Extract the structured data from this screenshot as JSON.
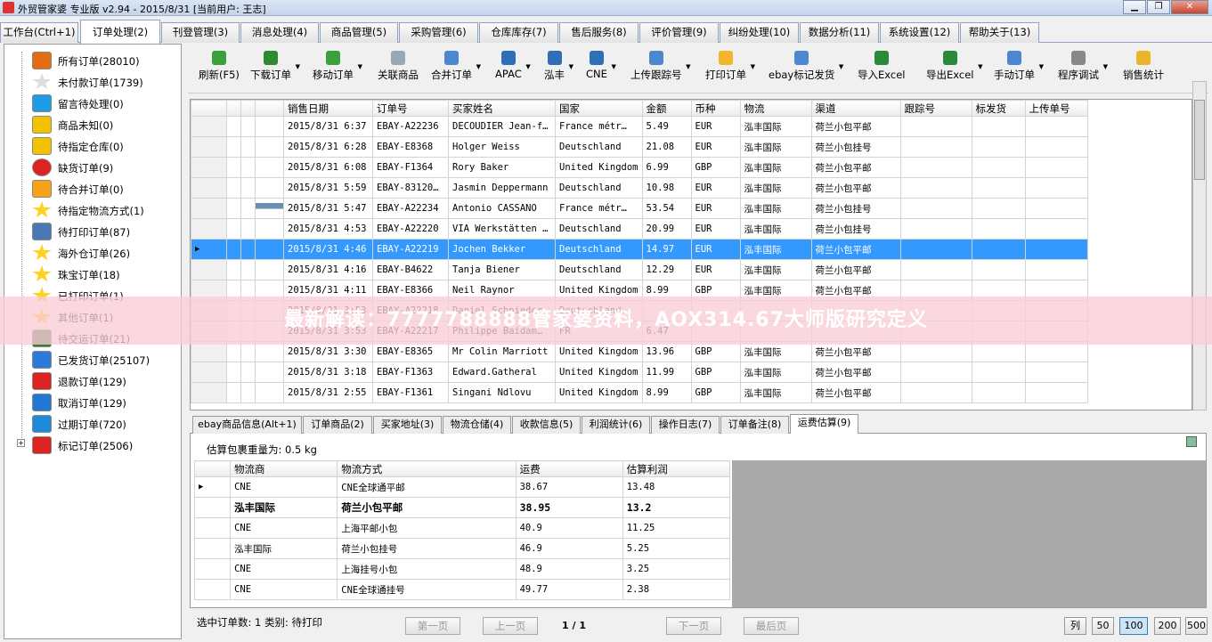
{
  "title": "外贸管家婆 专业版 v2.94 - 2015/8/31 [当前用户: 王志]",
  "window_buttons": {
    "min": "▁",
    "max": "❐",
    "close": "✕"
  },
  "main_tabs": [
    "工作台(Ctrl+1)",
    "订单处理(2)",
    "刊登管理(3)",
    "消息处理(4)",
    "商品管理(5)",
    "采购管理(6)",
    "仓库库存(7)",
    "售后服务(8)",
    "评价管理(9)",
    "纠纷处理(10)",
    "数据分析(11)",
    "系统设置(12)",
    "帮助关于(13)"
  ],
  "tree": [
    {
      "label": "所有订单(28010)",
      "icon": "house-icon",
      "color": "#e46c12"
    },
    {
      "label": "未付款订单(1739)",
      "icon": "star-outline-icon",
      "color": "#ffffff"
    },
    {
      "label": "留言待处理(0)",
      "icon": "speech-bubble-icon",
      "color": "#1e9be6"
    },
    {
      "label": "商品未知(0)",
      "icon": "warning-icon",
      "color": "#f2c200"
    },
    {
      "label": "待指定仓库(0)",
      "icon": "warning-icon",
      "color": "#f2c200"
    },
    {
      "label": "缺货订单(9)",
      "icon": "no-entry-icon",
      "color": "#dd2222"
    },
    {
      "label": "待合并订单(0)",
      "icon": "folder-icon",
      "color": "#f7a21a"
    },
    {
      "label": "待指定物流方式(1)",
      "icon": "star-icon",
      "color": "#ffd21f"
    },
    {
      "label": "待打印订单(87)",
      "icon": "printer-icon",
      "color": "#4a78b5"
    },
    {
      "label": "海外仓订单(26)",
      "icon": "star-icon",
      "color": "#ffd21f"
    },
    {
      "label": "珠宝订单(18)",
      "icon": "star-icon",
      "color": "#ffd21f"
    },
    {
      "label": "已打印订单(1)",
      "icon": "star-icon",
      "color": "#ffd21f"
    },
    {
      "label": "其他订单(1)",
      "icon": "star-icon",
      "color": "#ffd21f"
    },
    {
      "label": "待交运订单(21)",
      "icon": "person-icon",
      "color": "#3a7d3a"
    },
    {
      "label": "已发货订单(25107)",
      "icon": "truck-icon",
      "color": "#2c7bd8"
    },
    {
      "label": "退款订单(129)",
      "icon": "refund-icon",
      "color": "#dd2222"
    },
    {
      "label": "取消订单(129)",
      "icon": "cancel-icon",
      "color": "#1f78d1"
    },
    {
      "label": "过期订单(720)",
      "icon": "expired-icon",
      "color": "#1f8ad8"
    },
    {
      "label": "标记订单(2506)",
      "icon": "flag-icon",
      "color": "#dd2222"
    }
  ],
  "toolbar": [
    {
      "label": "刷新(F5)",
      "icon": "refresh-icon",
      "color": "#3aa03a",
      "dropdown": false
    },
    {
      "label": "下载订单",
      "icon": "download-icon",
      "color": "#2f8a2f",
      "dropdown": true
    },
    {
      "label": "移动订单",
      "icon": "move-icon",
      "color": "#3aa03a",
      "dropdown": true
    },
    {
      "label": "关联商品",
      "icon": "link-icon",
      "color": "#9aa6b2",
      "dropdown": false
    },
    {
      "label": "合并订单",
      "icon": "merge-icon",
      "color": "#4c88cf",
      "dropdown": true
    },
    {
      "label": "APAC",
      "icon": "apac-icon",
      "color": "#2e6fb8",
      "dropdown": true
    },
    {
      "label": "泓丰",
      "icon": "hongfeng-icon",
      "color": "#2e6fb8",
      "dropdown": true
    },
    {
      "label": "CNE",
      "icon": "cne-icon",
      "color": "#2e6fb8",
      "dropdown": true
    },
    {
      "label": "上传跟踪号",
      "icon": "upload-icon",
      "color": "#4c88cf",
      "dropdown": true
    },
    {
      "label": "打印订单",
      "icon": "print-icon",
      "color": "#f2b82a",
      "dropdown": true
    },
    {
      "label": "ebay标记发货",
      "icon": "ebay-mark-icon",
      "color": "#4c88cf",
      "dropdown": true
    },
    {
      "label": "导入Excel",
      "icon": "excel-import-icon",
      "color": "#2a8a3c",
      "dropdown": false
    },
    {
      "label": "导出Excel",
      "icon": "excel-export-icon",
      "color": "#2a8a3c",
      "dropdown": true
    },
    {
      "label": "手动订单",
      "icon": "manual-order-icon",
      "color": "#4c88cf",
      "dropdown": true
    },
    {
      "label": "程序调试",
      "icon": "debug-gear-icon",
      "color": "#888888",
      "dropdown": true
    },
    {
      "label": "销售统计",
      "icon": "stats-icon",
      "color": "#e8b628",
      "dropdown": false
    }
  ],
  "grid": {
    "columns": [
      "销售日期",
      "订单号",
      "买家姓名",
      "国家",
      "金额",
      "币种",
      "物流",
      "渠道",
      "跟踪号",
      "标发货",
      "上传单号"
    ],
    "rows": [
      [
        "2015/8/31 6:37",
        "EBAY-A22236",
        "DECOUDIER Jean-f…",
        "France métr…",
        "5.49",
        "EUR",
        "泓丰国际",
        "荷兰小包平邮",
        "",
        "",
        ""
      ],
      [
        "2015/8/31 6:28",
        "EBAY-E8368",
        "Holger Weiss",
        "Deutschland",
        "21.08",
        "EUR",
        "泓丰国际",
        "荷兰小包挂号",
        "",
        "",
        ""
      ],
      [
        "2015/8/31 6:08",
        "EBAY-F1364",
        "Rory Baker",
        "United Kingdom",
        "6.99",
        "GBP",
        "泓丰国际",
        "荷兰小包平邮",
        "",
        "",
        ""
      ],
      [
        "2015/8/31 5:59",
        "EBAY-83120…",
        "Jasmin Deppermann",
        "Deutschland",
        "10.98",
        "EUR",
        "泓丰国际",
        "荷兰小包平邮",
        "",
        "",
        ""
      ],
      [
        "2015/8/31 5:47",
        "EBAY-A22234",
        "Antonio CASSANO",
        "France métr…",
        "53.54",
        "EUR",
        "泓丰国际",
        "荷兰小包挂号",
        "",
        "",
        ""
      ],
      [
        "2015/8/31 4:53",
        "EBAY-A22220",
        "VIA Werkstätten …",
        "Deutschland",
        "20.99",
        "EUR",
        "泓丰国际",
        "荷兰小包挂号",
        "",
        "",
        ""
      ],
      [
        "2015/8/31 4:46",
        "EBAY-A22219",
        "Jochen Bekker",
        "Deutschland",
        "14.97",
        "EUR",
        "泓丰国际",
        "荷兰小包平邮",
        "",
        "",
        ""
      ],
      [
        "2015/8/31 4:16",
        "EBAY-B4622",
        "Tanja Biener",
        "Deutschland",
        "12.29",
        "EUR",
        "泓丰国际",
        "荷兰小包平邮",
        "",
        "",
        ""
      ],
      [
        "2015/8/31 4:11",
        "EBAY-E8366",
        "Neil Raynor",
        "United Kingdom",
        "8.99",
        "GBP",
        "泓丰国际",
        "荷兰小包平邮",
        "",
        "",
        ""
      ],
      [
        "2015/8/31 3:53",
        "EBAY-A22218",
        "Daniel Schnieder",
        "Deutschland",
        "",
        "",
        "",
        "",
        "",
        "",
        ""
      ],
      [
        "2015/8/31 3:53",
        "EBAY-A22217",
        "Philippe Baidam…",
        "FR",
        "6.47",
        "",
        "",
        "",
        "",
        "",
        ""
      ],
      [
        "2015/8/31 3:30",
        "EBAY-E8365",
        "Mr Colin Marriott",
        "United Kingdom",
        "13.96",
        "GBP",
        "泓丰国际",
        "荷兰小包平邮",
        "",
        "",
        ""
      ],
      [
        "2015/8/31 3:18",
        "EBAY-F1363",
        "Edward.Gatheral",
        "United Kingdom",
        "11.99",
        "GBP",
        "泓丰国际",
        "荷兰小包平邮",
        "",
        "",
        ""
      ],
      [
        "2015/8/31 2:55",
        "EBAY-F1361",
        "Singani Ndlovu",
        "United Kingdom",
        "8.99",
        "GBP",
        "泓丰国际",
        "荷兰小包平邮",
        "",
        "",
        ""
      ]
    ],
    "selected_index": 6,
    "person_icon_row": 4
  },
  "detail_tabs": [
    "ebay商品信息(Alt+1)",
    "订单商品(2)",
    "买家地址(3)",
    "物流仓储(4)",
    "收款信息(5)",
    "利润统计(6)",
    "操作日志(7)",
    "订单备注(8)",
    "运费估算(9)"
  ],
  "estimate": {
    "weight_label": "估算包裹重量为: 0.5 kg",
    "columns": [
      "物流商",
      "物流方式",
      "运费",
      "估算利润"
    ],
    "rows": [
      [
        "CNE",
        "CNE全球通平邮",
        "38.67",
        "13.48"
      ],
      [
        "泓丰国际",
        "荷兰小包平邮",
        "38.95",
        "13.2"
      ],
      [
        "CNE",
        "上海平邮小包",
        "40.9",
        "11.25"
      ],
      [
        "泓丰国际",
        "荷兰小包挂号",
        "46.9",
        "5.25"
      ],
      [
        "CNE",
        "上海挂号小包",
        "48.9",
        "3.25"
      ],
      [
        "CNE",
        "CNE全球通挂号",
        "49.77",
        "2.38"
      ]
    ],
    "bold_row": 1
  },
  "status": {
    "text": "选中订单数: 1 类别: 待打印",
    "page": "1 / 1"
  },
  "nav": {
    "first": "第一页",
    "prev": "上一页",
    "next": "下一页",
    "last": "最后页"
  },
  "page_size_buttons": [
    "列",
    "50",
    "100",
    "200",
    "500"
  ],
  "page_size_active": "100",
  "watermark": "最新解读：7777788888管家婆资料，AOX314.67大师版研究定义"
}
